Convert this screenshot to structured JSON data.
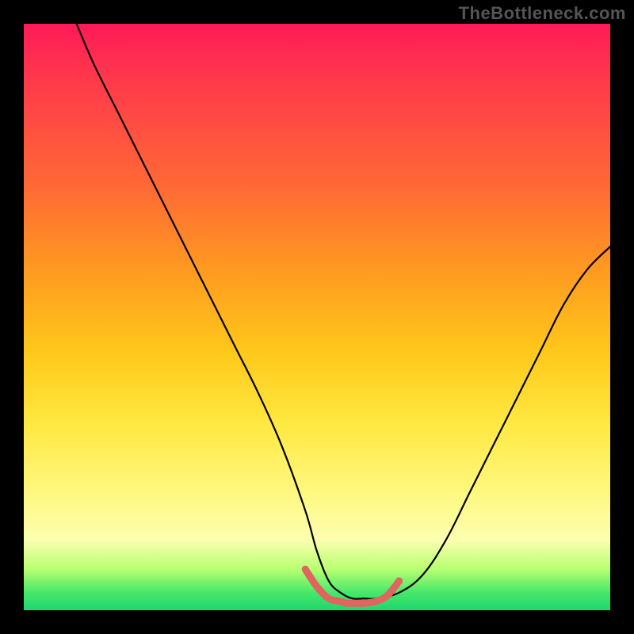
{
  "watermark": "TheBottleneck.com",
  "chart_data": {
    "type": "line",
    "title": "",
    "xlabel": "",
    "ylabel": "",
    "xlim": [
      0,
      100
    ],
    "ylim": [
      0,
      100
    ],
    "grid": false,
    "legend": false,
    "series": [
      {
        "name": "bottleneck-curve",
        "stroke": "#000000",
        "x": [
          9,
          12,
          16,
          20,
          24,
          28,
          32,
          36,
          40,
          44,
          48,
          50,
          52,
          54,
          56,
          58,
          60,
          64,
          68,
          72,
          76,
          80,
          84,
          88,
          92,
          96,
          100
        ],
        "values": [
          100,
          93,
          85,
          77,
          69,
          61,
          53,
          45,
          37,
          28,
          17,
          10,
          5,
          3,
          2,
          2,
          2,
          3,
          6,
          12,
          20,
          28,
          36,
          44,
          52,
          58,
          62
        ]
      },
      {
        "name": "sweet-spot-marker",
        "stroke": "#e0645f",
        "x": [
          48,
          50,
          52,
          54,
          55,
          56,
          58,
          60,
          62,
          64
        ],
        "values": [
          7,
          4,
          2,
          1.5,
          1.2,
          1.2,
          1.2,
          1.5,
          2.5,
          5
        ]
      }
    ],
    "background_gradient_stops": [
      {
        "pct": 0,
        "color": "#ff1a58"
      },
      {
        "pct": 10,
        "color": "#ff3a4a"
      },
      {
        "pct": 28,
        "color": "#ff6a35"
      },
      {
        "pct": 42,
        "color": "#ff9a20"
      },
      {
        "pct": 56,
        "color": "#ffc81a"
      },
      {
        "pct": 68,
        "color": "#ffe840"
      },
      {
        "pct": 80,
        "color": "#fff880"
      },
      {
        "pct": 88,
        "color": "#fbffb0"
      },
      {
        "pct": 93,
        "color": "#b8ff70"
      },
      {
        "pct": 97,
        "color": "#46e86a"
      },
      {
        "pct": 100,
        "color": "#1fd66f"
      }
    ]
  }
}
